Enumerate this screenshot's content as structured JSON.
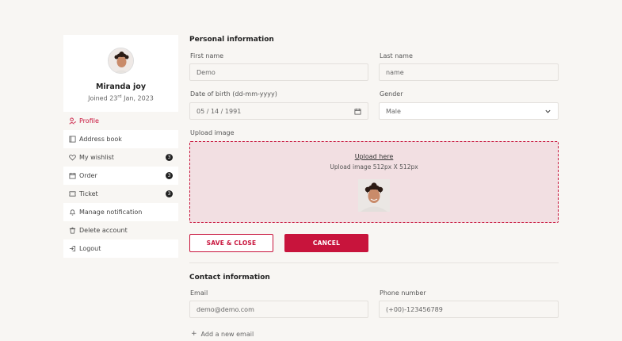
{
  "profile": {
    "name": "Miranda joy",
    "joined_prefix": "Joined 23",
    "joined_sup": "rd",
    "joined_suffix": " Jan, 2023"
  },
  "sidebar": {
    "items": [
      {
        "label": "Profile",
        "icon": "user-icon"
      },
      {
        "label": "Address book",
        "icon": "book-icon"
      },
      {
        "label": "My wishlist",
        "icon": "heart-icon",
        "badge": "3"
      },
      {
        "label": "Order",
        "icon": "calendar-icon",
        "badge": "3"
      },
      {
        "label": "Ticket",
        "icon": "ticket-icon",
        "badge": "3"
      },
      {
        "label": "Manage notification",
        "icon": "bell-icon"
      },
      {
        "label": "Delete account",
        "icon": "trash-icon"
      },
      {
        "label": "Logout",
        "icon": "logout-icon"
      }
    ]
  },
  "personal": {
    "title": "Personal information",
    "first_name_label": "First name",
    "first_name_value": "Demo",
    "last_name_label": "Last name",
    "last_name_placeholder": "name",
    "dob_label": "Date of birth (dd-mm-yyyy)",
    "dob_value": "05 / 14 / 1991",
    "gender_label": "Gender",
    "gender_value": "Male",
    "upload_label": "Upload image",
    "upload_link": "Upload here",
    "upload_hint": "Upload image 512px X 512px"
  },
  "actions": {
    "save_close": "SAVE & CLOSE",
    "cancel": "CANCEL"
  },
  "contact": {
    "title": "Contact information",
    "email_label": "Email",
    "email_placeholder": "demo@demo.com",
    "phone_label": "Phone number",
    "phone_placeholder": "(+00)-123456789",
    "add_email": "Add a new email"
  },
  "colors": {
    "accent": "#c8143c",
    "background": "#f8f6f3",
    "upload_bg": "#f2dfe2"
  }
}
